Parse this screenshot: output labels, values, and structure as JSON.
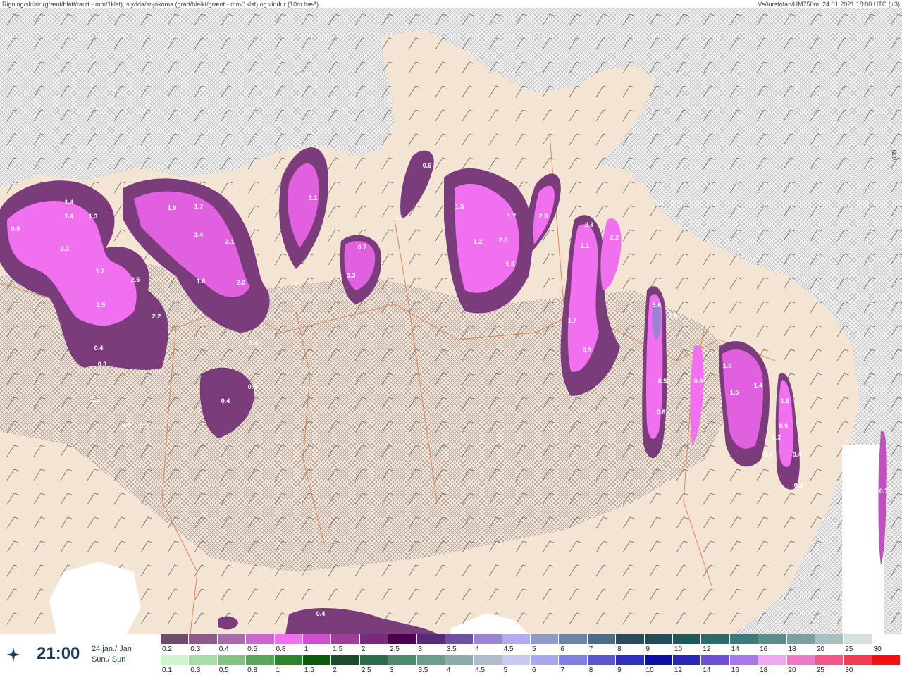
{
  "header": {
    "left": "Rigning/skúrir (grænt/blátt/rautt - mm/1klst), slydda/snjókoma (grátt/bleikt/grænt - mm/1klst) og vindur (10m hæð)",
    "right": "Veðurstofan/HM750m: 24.01.2021 18:00 UTC (+3)"
  },
  "time_panel": {
    "time": "21:00",
    "date_line1": "24.jan./ Jan",
    "date_line2": "Sun./ Sun",
    "icon": "compass-star-icon"
  },
  "map": {
    "edge_label": "66N",
    "precip_labels": [
      "1.4",
      "1.4",
      "1.3",
      "0.9",
      "2.2",
      "1.7",
      "2.5",
      "1.5",
      "2.2",
      "0.4",
      "0.3",
      "0.2",
      "0.3",
      "0.3",
      "1.9",
      "1.7",
      "1.4",
      "3.1",
      "1.6",
      "2.0",
      "0.4",
      "0.5",
      "0.4",
      "3.1",
      "0.6",
      "0.7",
      "0.3",
      "0.6",
      "1.5",
      "1.2",
      "1.7",
      "2.0",
      "1.6",
      "2.0",
      "2.3",
      "2.1",
      "2.2",
      "1.7",
      "0.5",
      "5.6",
      "1.8",
      "0.5",
      "0.6",
      "0.8",
      "1.0",
      "1.5",
      "1.4",
      "1.6",
      "0.9",
      "0.4",
      "0.4",
      "0.3",
      "0.7",
      "0.3",
      "0.4"
    ]
  },
  "legend": {
    "snow_colors": [
      "#6e4c6e",
      "#8c5a8c",
      "#a86aaa",
      "#cc66cc",
      "#f070f0",
      "#d050d0",
      "#a03c9a",
      "#7a2a78",
      "#4d0050",
      "#5a2a7a",
      "#7050a0",
      "#9a84d4",
      "#b4aaf0",
      "#8e9acc",
      "#6c84a8",
      "#4c6c88",
      "#2c4c5c",
      "#244c58",
      "#1c5a60",
      "#2c6a6c",
      "#3c7a7c",
      "#5c8c8c",
      "#7ca0a0",
      "#a8c0c0",
      "#d6e0e0",
      "#ffffff"
    ],
    "snow_labels": [
      "0.2",
      "0.3",
      "0.4",
      "0.5",
      "0.8",
      "1",
      "1.5",
      "2",
      "2.5",
      "3",
      "3.5",
      "4",
      "4.5",
      "5",
      "6",
      "7",
      "8",
      "9",
      "10",
      "12",
      "14",
      "16",
      "18",
      "20",
      "25",
      "30"
    ],
    "rain_colors": [
      "#ccf5cc",
      "#a8dca8",
      "#80c480",
      "#58a858",
      "#2c842c",
      "#0c5c0c",
      "#1c4c2c",
      "#2c6c4c",
      "#4c8c6c",
      "#6c9c8c",
      "#8cacac",
      "#aebccc",
      "#c8c8f0",
      "#a8a8ec",
      "#8080e0",
      "#5858cc",
      "#3030b8",
      "#1010a0",
      "#2828b0",
      "#7050d0",
      "#a878e8",
      "#f0a8f0",
      "#f078c8",
      "#f05888",
      "#f03c50",
      "#f01010"
    ],
    "rain_labels": [
      "0.1",
      "0.3",
      "0.5",
      "0.8",
      "1",
      "1.5",
      "2",
      "2.5",
      "3",
      "3.5",
      "4",
      "4.5",
      "5",
      "6",
      "7",
      "8",
      "9",
      "10",
      "12",
      "14",
      "16",
      "18",
      "20",
      "25",
      "30"
    ]
  }
}
